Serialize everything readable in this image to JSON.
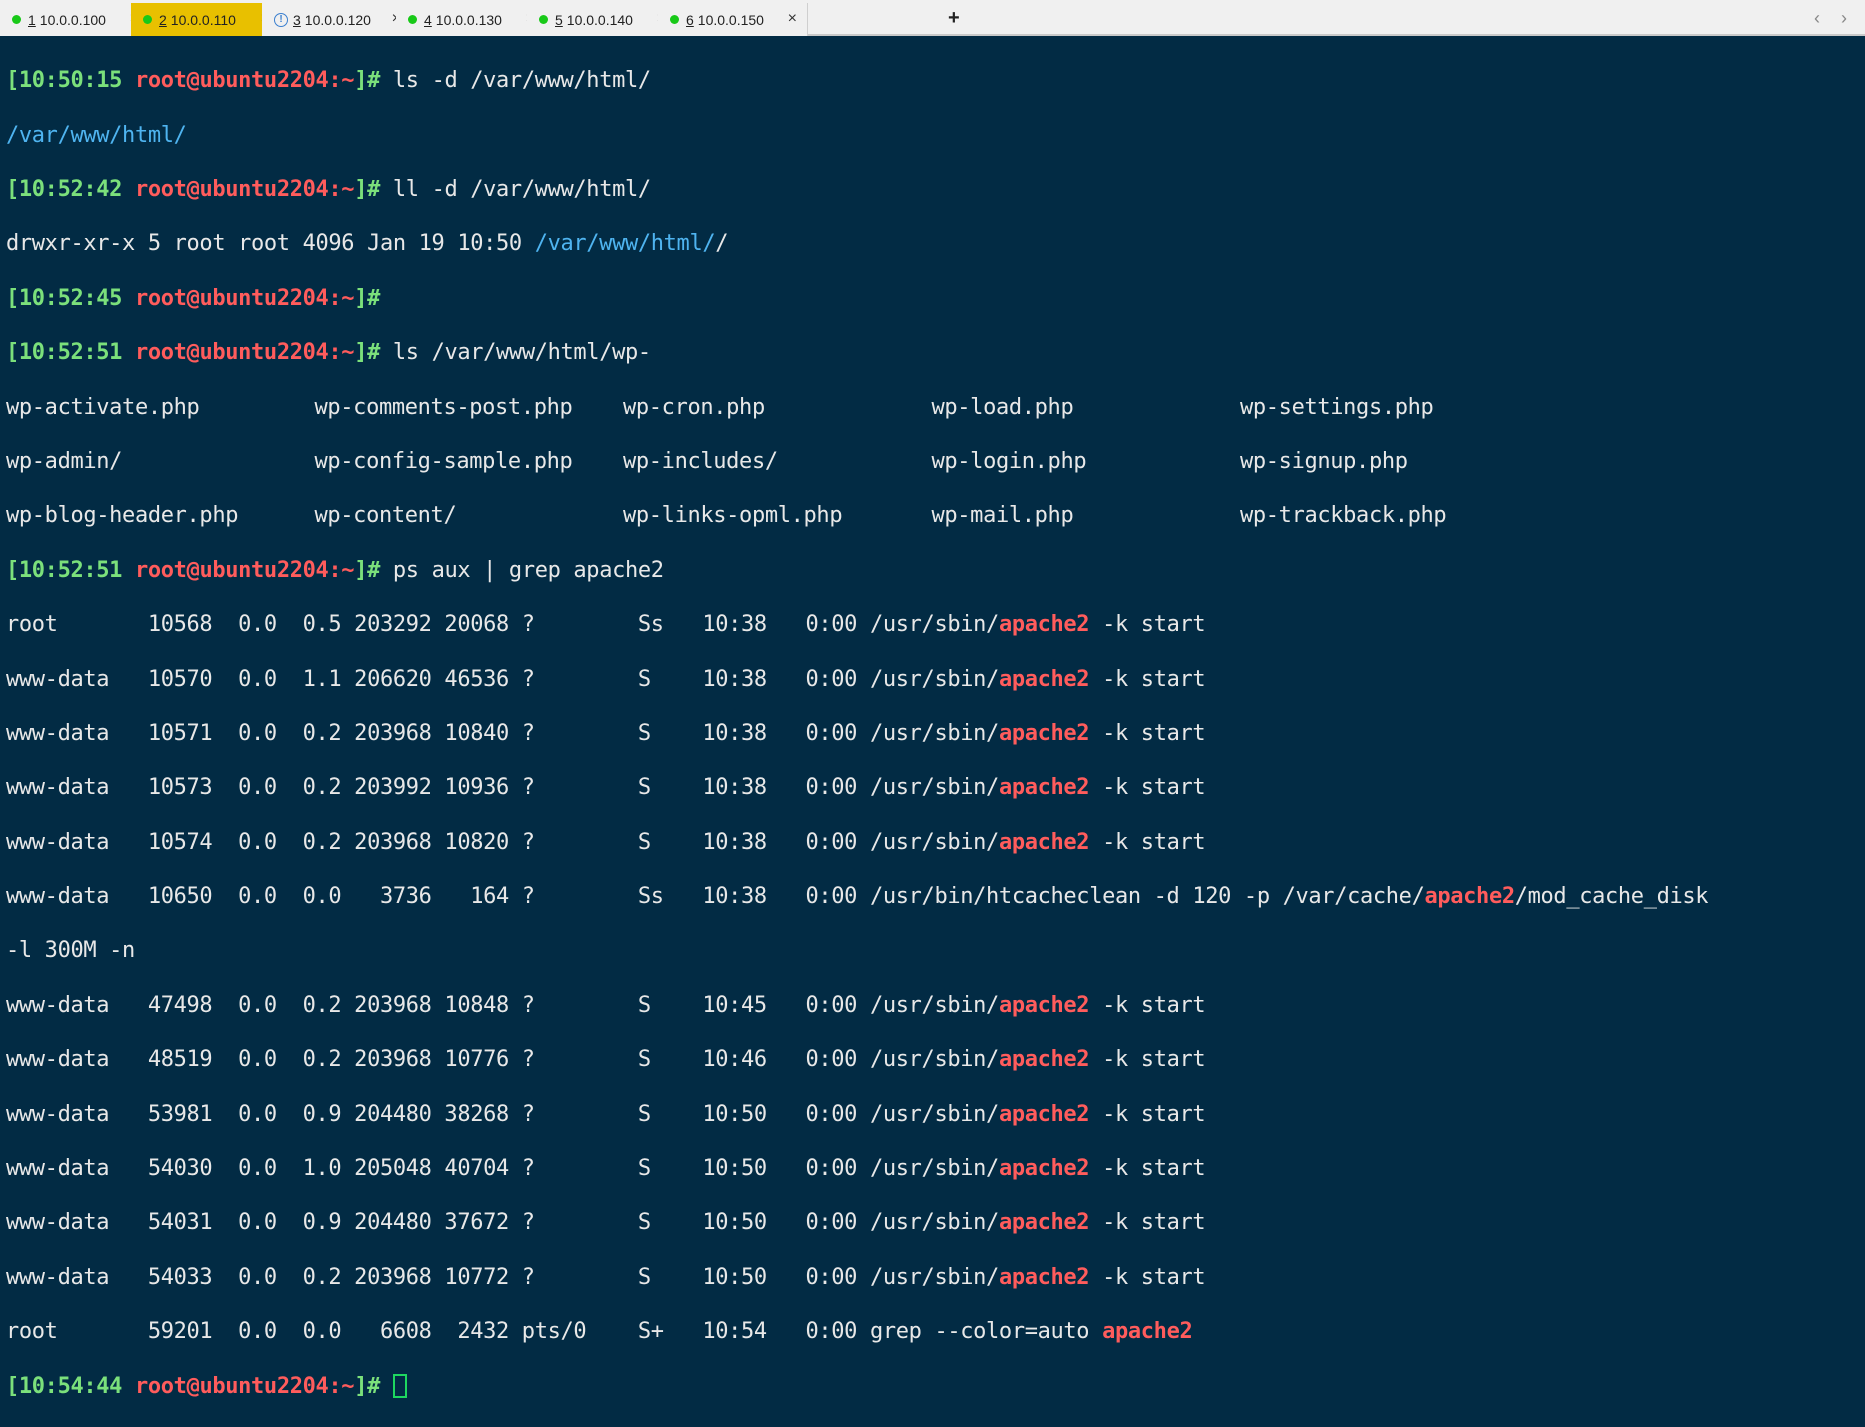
{
  "tabs": [
    {
      "num": "1",
      "host": "10.0.0.100",
      "status": "connected",
      "active": false
    },
    {
      "num": "2",
      "host": "10.0.0.110",
      "status": "connected",
      "active": true
    },
    {
      "num": "3",
      "host": "10.0.0.120",
      "status": "warning",
      "active": false
    },
    {
      "num": "4",
      "host": "10.0.0.130",
      "status": "connected",
      "active": false
    },
    {
      "num": "5",
      "host": "10.0.0.140",
      "status": "connected",
      "active": false
    },
    {
      "num": "6",
      "host": "10.0.0.150",
      "status": "connected",
      "active": false
    }
  ],
  "tab_close_glyph": "×",
  "new_tab_glyph": "+",
  "nav_glyphs": "‹ ›",
  "colors": {
    "connected": "#18c918",
    "active_tab": "#e8c000",
    "terminal_bg": "#022b44",
    "timestamp": "#7be07b",
    "user": "#ff5c5c",
    "directory": "#4fb4f0",
    "highlight": "#ff5c5c"
  },
  "prompt_user": "root@ubuntu2204:~",
  "lines": {
    "l1_ts": "[10:50:15",
    "l1_cmd": " ls -d /var/www/html/",
    "l2_dir": "/var/www/html/",
    "l3_ts": "[10:52:42",
    "l3_cmd": " ll -d /var/www/html/",
    "l4_pre": "drwxr-xr-x 5 root root 4096 Jan 19 10:50 ",
    "l4_dir": "/var/www/html/",
    "l4_post": "/",
    "l5_ts": "[10:52:45",
    "l6_ts": "[10:52:51",
    "l6_cmd": " ls /var/www/html/wp-",
    "l10_ts": "[10:52:51",
    "l10_cmd": " ps aux | grep apache2",
    "last_ts": "[10:54:44"
  },
  "wp_files": [
    [
      "wp-activate.php",
      "wp-comments-post.php",
      "wp-cron.php",
      "wp-load.php",
      "wp-settings.php"
    ],
    [
      "wp-admin/",
      "wp-config-sample.php",
      "wp-includes/",
      "wp-login.php",
      "wp-signup.php"
    ],
    [
      "wp-blog-header.php",
      "wp-content/",
      "wp-links-opml.php",
      "wp-mail.php",
      "wp-trackback.php"
    ]
  ],
  "ps_rows": [
    {
      "pre": "root       10568  0.0  0.5 203292 20068 ?        Ss   10:38   0:00 /usr/sbin/",
      "hl": "apache2",
      "post": " -k start"
    },
    {
      "pre": "www-data   10570  0.0  1.1 206620 46536 ?        S    10:38   0:00 /usr/sbin/",
      "hl": "apache2",
      "post": " -k start"
    },
    {
      "pre": "www-data   10571  0.0  0.2 203968 10840 ?        S    10:38   0:00 /usr/sbin/",
      "hl": "apache2",
      "post": " -k start"
    },
    {
      "pre": "www-data   10573  0.0  0.2 203992 10936 ?        S    10:38   0:00 /usr/sbin/",
      "hl": "apache2",
      "post": " -k start"
    },
    {
      "pre": "www-data   10574  0.0  0.2 203968 10820 ?        S    10:38   0:00 /usr/sbin/",
      "hl": "apache2",
      "post": " -k start"
    },
    {
      "pre": "www-data   10650  0.0  0.0   3736   164 ?        Ss   10:38   0:00 /usr/bin/htcacheclean -d 120 -p /var/cache/",
      "hl": "apache2",
      "post": "/mod_cache_disk"
    },
    {
      "pre": "-l 300M -n",
      "hl": "",
      "post": ""
    },
    {
      "pre": "www-data   47498  0.0  0.2 203968 10848 ?        S    10:45   0:00 /usr/sbin/",
      "hl": "apache2",
      "post": " -k start"
    },
    {
      "pre": "www-data   48519  0.0  0.2 203968 10776 ?        S    10:46   0:00 /usr/sbin/",
      "hl": "apache2",
      "post": " -k start"
    },
    {
      "pre": "www-data   53981  0.0  0.9 204480 38268 ?        S    10:50   0:00 /usr/sbin/",
      "hl": "apache2",
      "post": " -k start"
    },
    {
      "pre": "www-data   54030  0.0  1.0 205048 40704 ?        S    10:50   0:00 /usr/sbin/",
      "hl": "apache2",
      "post": " -k start"
    },
    {
      "pre": "www-data   54031  0.0  0.9 204480 37672 ?        S    10:50   0:00 /usr/sbin/",
      "hl": "apache2",
      "post": " -k start"
    },
    {
      "pre": "www-data   54033  0.0  0.2 203968 10772 ?        S    10:50   0:00 /usr/sbin/",
      "hl": "apache2",
      "post": " -k start"
    },
    {
      "pre": "root       59201  0.0  0.0   6608  2432 pts/0    S+   10:54   0:00 grep --color=auto ",
      "hl": "apache2",
      "post": ""
    }
  ]
}
